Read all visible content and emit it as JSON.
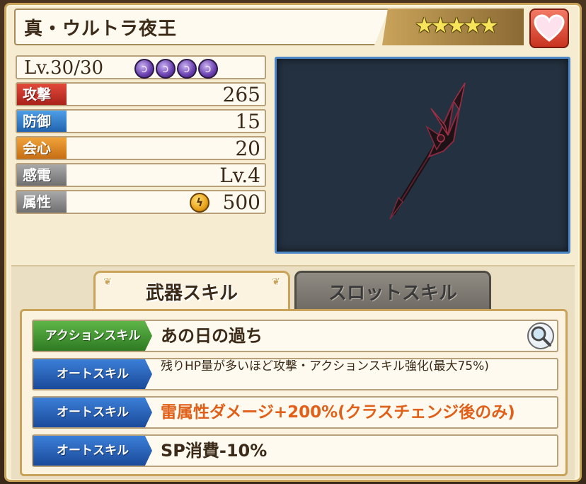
{
  "weapon": {
    "name": "真・ウルトラ夜王",
    "stars": "★★★★★",
    "level_text": "Lv.30/30",
    "orb_glyph": "ↄ"
  },
  "stats": [
    {
      "label": "攻撃",
      "value": "265",
      "color": "red"
    },
    {
      "label": "防御",
      "value": "15",
      "color": "blue"
    },
    {
      "label": "会心",
      "value": "20",
      "color": "orange"
    },
    {
      "label": "感電",
      "value": "Lv.4",
      "color": "gray"
    },
    {
      "label": "属性",
      "value": "500",
      "color": "gray"
    }
  ],
  "tabs": {
    "weapon_skill": "武器スキル",
    "slot_skill": "スロットスキル"
  },
  "skills": [
    {
      "tag": "アクションスキル",
      "text": "あの日の過ち"
    },
    {
      "tag": "オートスキル",
      "text": "残りHP量が多いほど攻撃・アクションスキル強化(最大75%)"
    },
    {
      "tag": "オートスキル",
      "text": "雷属性ダメージ+200%(クラスチェンジ後のみ)"
    },
    {
      "tag": "オートスキル",
      "text": "SP消費-10%"
    }
  ],
  "colors": {
    "accent_gold": "#c9a35a",
    "stat_red": "#c5352a",
    "stat_blue": "#3a83d0",
    "stat_orange": "#e08a28",
    "stat_gray": "#8a8a8a",
    "skill_orange": "#e0601a"
  },
  "icons": {
    "favorite": "heart-icon",
    "element": "lightning-icon",
    "detail": "magnifier-icon"
  }
}
